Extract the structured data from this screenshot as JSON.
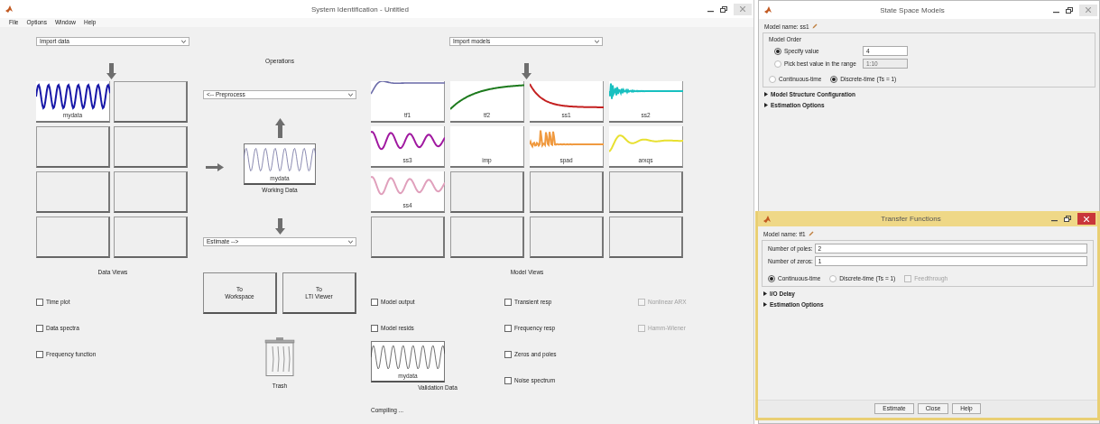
{
  "window": {
    "title": "System Identification - Untitled"
  },
  "menu": [
    "File",
    "Options",
    "Window",
    "Help"
  ],
  "data_import": {
    "value": "Import data"
  },
  "data_boards": [
    {
      "kind": "pulse",
      "name": "mydata",
      "color": "#1818a8"
    },
    {
      "kind": "empty"
    },
    {
      "kind": "empty"
    },
    {
      "kind": "empty"
    },
    {
      "kind": "empty"
    },
    {
      "kind": "empty"
    },
    {
      "kind": "empty"
    },
    {
      "kind": "empty"
    }
  ],
  "data_views": {
    "title": "Data Views",
    "checks": [
      {
        "label": "Time plot",
        "checked": false
      },
      {
        "label": "Data spectra",
        "checked": false
      },
      {
        "label": "Frequency function",
        "checked": false
      }
    ]
  },
  "operations": {
    "title": "Operations",
    "preprocess": "<-- Preprocess",
    "working_data": {
      "name": "mydata",
      "label": "Working Data"
    },
    "estimate": "Estimate -->",
    "buttons": [
      [
        "To",
        "Workspace"
      ],
      [
        "To",
        "LTI Viewer"
      ]
    ],
    "trash": "Trash"
  },
  "model_import": {
    "value": "Import models"
  },
  "model_boards": [
    {
      "kind": "overshoot",
      "name": "tf1",
      "color": "#6a6aa8"
    },
    {
      "kind": "rise",
      "name": "tf2",
      "color": "#1d7a1d"
    },
    {
      "kind": "decay",
      "name": "ss1",
      "color": "#c42020"
    },
    {
      "kind": "ringing",
      "name": "ss2",
      "color": "#18c0c0"
    },
    {
      "kind": "wave",
      "name": "ss3",
      "color": "#a018a0"
    },
    {
      "kind": "blank",
      "name": "imp"
    },
    {
      "kind": "spikes",
      "name": "spad",
      "color": "#f09a40"
    },
    {
      "kind": "damped",
      "name": "arxqs",
      "color": "#e8e030"
    },
    {
      "kind": "wave",
      "name": "ss4",
      "color": "#e0a0bc"
    },
    {
      "kind": "empty"
    },
    {
      "kind": "empty"
    },
    {
      "kind": "empty"
    },
    {
      "kind": "empty"
    },
    {
      "kind": "empty"
    },
    {
      "kind": "empty"
    },
    {
      "kind": "empty"
    }
  ],
  "model_views": {
    "title": "Model Views",
    "columns": [
      [
        {
          "label": "Model output",
          "checked": false,
          "disabled": false
        },
        {
          "label": "Model resids",
          "checked": false,
          "disabled": false
        }
      ],
      [
        {
          "label": "Transient resp",
          "checked": false,
          "disabled": false
        },
        {
          "label": "Frequency resp",
          "checked": false,
          "disabled": false
        },
        {
          "label": "Zeros and poles",
          "checked": false,
          "disabled": false
        },
        {
          "label": "Noise spectrum",
          "checked": false,
          "disabled": false
        }
      ],
      [
        {
          "label": "Nonlinear ARX",
          "checked": false,
          "disabled": true
        },
        {
          "label": "Hamm-Wiener",
          "checked": false,
          "disabled": true
        }
      ]
    ]
  },
  "validation_data": {
    "name": "mydata",
    "label": "Validation Data"
  },
  "status": "Compiling ...",
  "ss_window": {
    "title": "State Space Models",
    "model_name": "Model name: ss1",
    "model_order": {
      "title": "Model Order",
      "options": [
        {
          "label": "Specify value",
          "selected": true,
          "value": "4",
          "disabled": false
        },
        {
          "label": "Pick best value in the range",
          "selected": false,
          "value": "1:10",
          "disabled": true
        }
      ]
    },
    "time": [
      {
        "label": "Continuous-time",
        "selected": false
      },
      {
        "label": "Discrete-time (Ts = 1)",
        "selected": true
      }
    ],
    "sections": [
      {
        "label": "Model Structure Configuration",
        "expanded": false
      },
      {
        "label": "Estimation Options",
        "expanded": false
      }
    ]
  },
  "tf_window": {
    "title": "Transfer Functions",
    "model_name": "Model name: tf1",
    "fields": [
      {
        "label": "Number of poles:",
        "value": "2"
      },
      {
        "label": "Number of zeros:",
        "value": "1"
      }
    ],
    "time": [
      {
        "label": "Continuous-time",
        "selected": true
      },
      {
        "label": "Discrete-time (Ts = 1)",
        "selected": false
      }
    ],
    "feedthrough": {
      "label": "Feedthrough",
      "checked": false,
      "disabled": true
    },
    "sections": [
      {
        "label": "I/O Delay",
        "expanded": false
      },
      {
        "label": "Estimation Options",
        "expanded": false
      }
    ],
    "buttons": [
      "Estimate",
      "Close",
      "Help"
    ]
  }
}
